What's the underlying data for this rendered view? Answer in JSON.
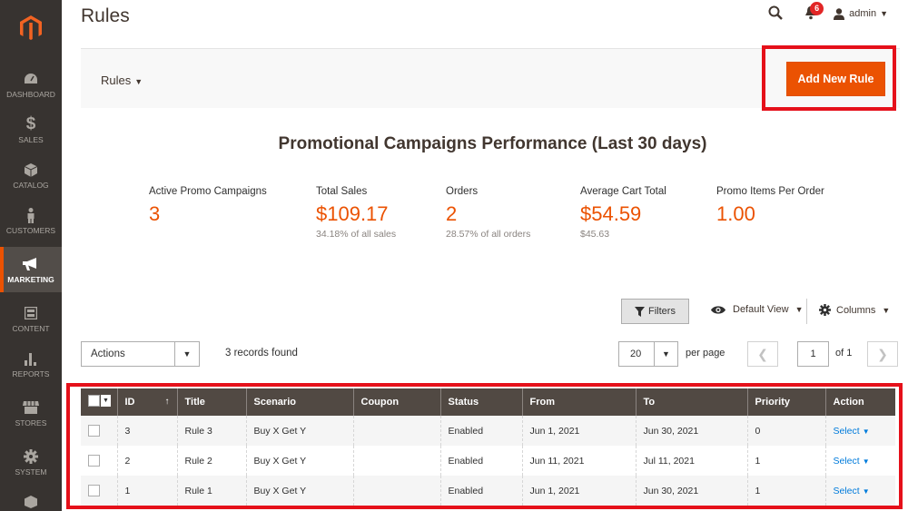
{
  "sidebar": {
    "items": [
      {
        "label": "DASHBOARD",
        "icon": "dashboard-icon"
      },
      {
        "label": "SALES",
        "icon": "dollar-icon"
      },
      {
        "label": "CATALOG",
        "icon": "cube-icon"
      },
      {
        "label": "CUSTOMERS",
        "icon": "person-icon"
      },
      {
        "label": "MARKETING",
        "icon": "megaphone-icon"
      },
      {
        "label": "CONTENT",
        "icon": "layout-icon"
      },
      {
        "label": "REPORTS",
        "icon": "bar-chart-icon"
      },
      {
        "label": "STORES",
        "icon": "store-icon"
      },
      {
        "label": "SYSTEM",
        "icon": "gear-icon"
      }
    ]
  },
  "header": {
    "title": "Rules",
    "notifications_count": "6",
    "user": "admin"
  },
  "toolbar": {
    "switcher_label": "Rules",
    "add_button": "Add New Rule"
  },
  "performance": {
    "title": "Promotional Campaigns Performance (Last 30 days)",
    "stats": [
      {
        "label": "Active Promo Campaigns",
        "value": "3",
        "sub": ""
      },
      {
        "label": "Total Sales",
        "value": "$109.17",
        "sub": "34.18% of all sales"
      },
      {
        "label": "Orders",
        "value": "2",
        "sub": "28.57% of all orders"
      },
      {
        "label": "Average Cart Total",
        "value": "$54.59",
        "sub": "$45.63"
      },
      {
        "label": "Promo Items Per Order",
        "value": "1.00",
        "sub": ""
      }
    ]
  },
  "grid": {
    "filters_label": "Filters",
    "view_label": "Default View",
    "columns_label": "Columns",
    "actions_label": "Actions",
    "records_found": "3 records found",
    "per_page_value": "20",
    "per_page_label": "per page",
    "current_page": "1",
    "of_pages": "of 1",
    "columns": [
      "ID",
      "Title",
      "Scenario",
      "Coupon",
      "Status",
      "From",
      "To",
      "Priority",
      "Action"
    ],
    "rows": [
      {
        "id": "3",
        "title": "Rule 3",
        "scenario": "Buy X Get Y",
        "coupon": "",
        "status": "Enabled",
        "from": "Jun 1, 2021",
        "to": "Jun 30, 2021",
        "priority": "0",
        "action": "Select"
      },
      {
        "id": "2",
        "title": "Rule 2",
        "scenario": "Buy X Get Y",
        "coupon": "",
        "status": "Enabled",
        "from": "Jun 11, 2021",
        "to": "Jul 11, 2021",
        "priority": "1",
        "action": "Select"
      },
      {
        "id": "1",
        "title": "Rule 1",
        "scenario": "Buy X Get Y",
        "coupon": "",
        "status": "Enabled",
        "from": "Jun 1, 2021",
        "to": "Jun 30, 2021",
        "priority": "1",
        "action": "Select"
      }
    ]
  },
  "colors": {
    "accent": "#eb5202",
    "sidebar_bg": "#373330",
    "table_header": "#514943",
    "highlight": "#e5101a",
    "link": "#007bdb"
  }
}
